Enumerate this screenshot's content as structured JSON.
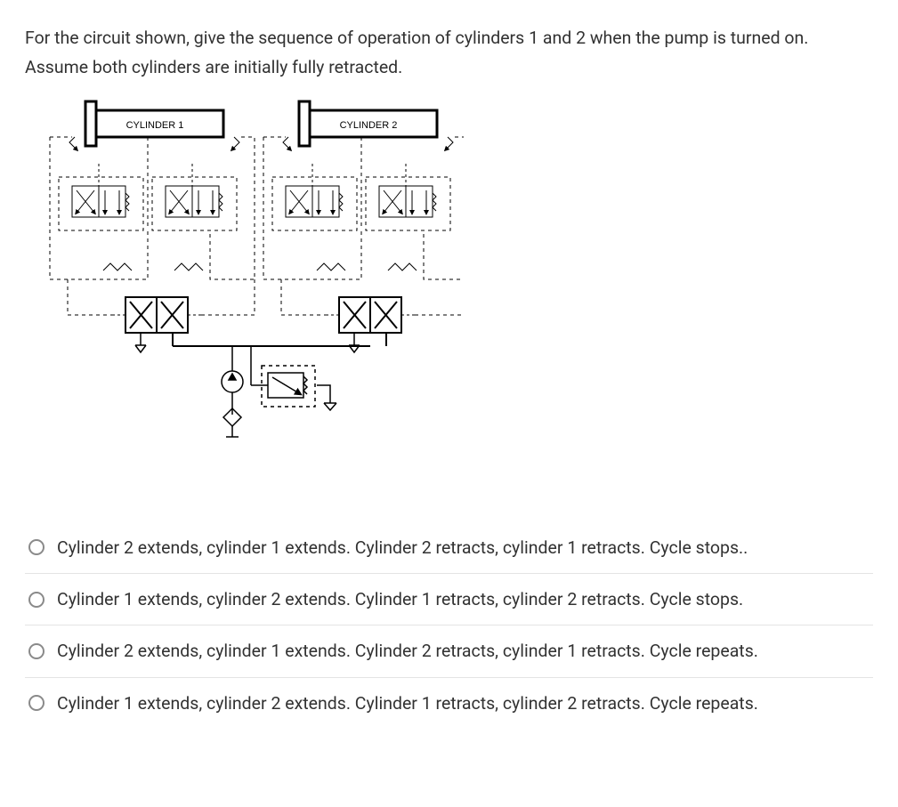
{
  "question": {
    "line1": "For the circuit shown, give the sequence of operation of cylinders 1 and 2 when the pump is turned on.",
    "line2": "Assume both cylinders are initially fully retracted."
  },
  "diagram": {
    "labels": {
      "cyl1": "CYLINDER 1",
      "cyl2": "CYLINDER 2"
    }
  },
  "options": [
    {
      "text": "Cylinder 2 extends, cylinder 1 extends. Cylinder 2 retracts, cylinder 1 retracts. Cycle stops.."
    },
    {
      "text": "Cylinder 1 extends, cylinder 2 extends. Cylinder 1 retracts, cylinder 2 retracts. Cycle stops."
    },
    {
      "text": "Cylinder 2 extends, cylinder 1 extends. Cylinder 2 retracts, cylinder 1 retracts. Cycle repeats."
    },
    {
      "text": "Cylinder 1 extends, cylinder 2 extends. Cylinder 1 retracts, cylinder 2 retracts. Cycle repeats."
    }
  ]
}
